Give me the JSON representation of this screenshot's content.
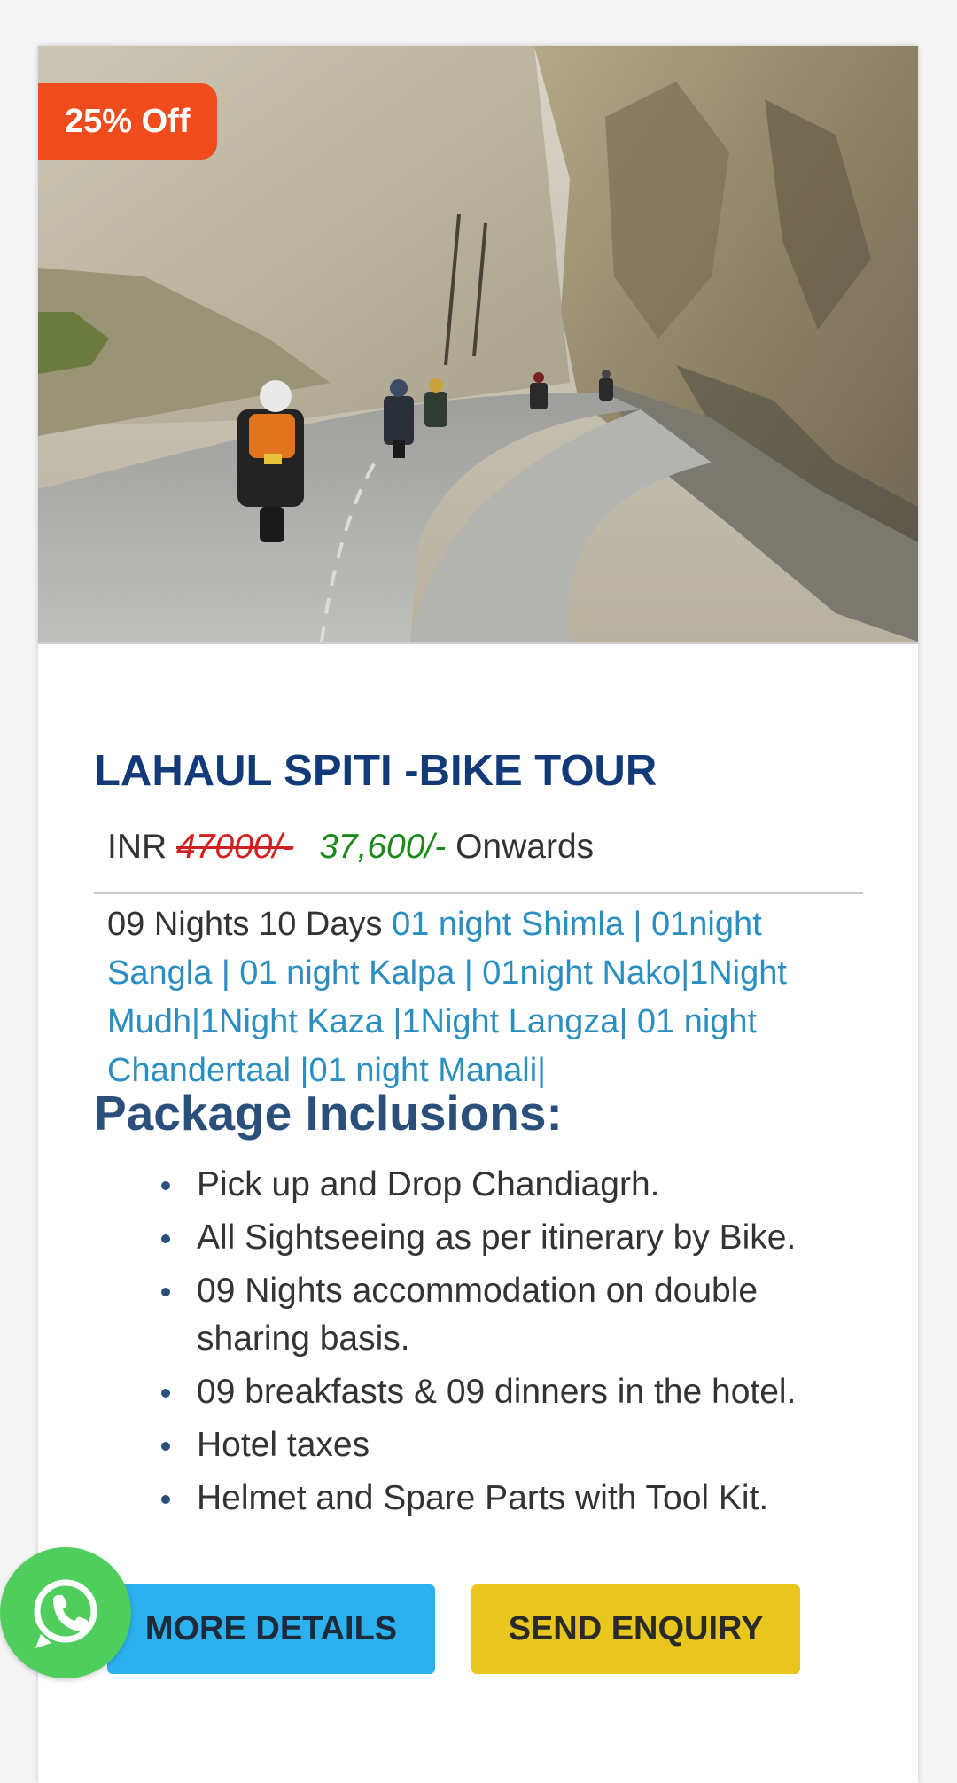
{
  "card": {
    "badge": "25% Off",
    "hero_image_alt": "Motorcyclists riding on a mountain road",
    "title": "LAHAUL SPITI -BIKE TOUR",
    "price": {
      "currency": "INR",
      "old": "47000/-",
      "new": "37,600/-",
      "suffix": "Onwards"
    },
    "duration": "09 Nights 10 Days",
    "itinerary": "01 night Shimla | 01night Sangla | 01 night Kalpa | 01night Nako|1Night Mudh|1Night Kaza |1Night Langza| 01 night Chandertaal |01 night Manali|",
    "inclusions_heading": "Package Inclusions:",
    "inclusions": [
      "Pick up and Drop Chandiagrh.",
      "All Sightseeing as per itinerary by Bike.",
      "09 Nights accommodation on double sharing basis.",
      "09 breakfasts & 09 dinners in the hotel.",
      "Hotel taxes",
      "Helmet and Spare Parts with Tool Kit."
    ],
    "buttons": {
      "more_details": "MORE DETAILS",
      "send_enquiry": "SEND ENQUIRY"
    }
  },
  "floating": {
    "whatsapp_icon": "whatsapp-icon"
  },
  "colors": {
    "badge": "#f04b1c",
    "title": "#123a78",
    "old_price": "#d22020",
    "new_price": "#1a8a1a",
    "itinerary_link": "#2a8fc0",
    "more_details_button": "#2bb1ee",
    "send_enquiry_button": "#e8c61e",
    "whatsapp": "#4fce5d"
  }
}
